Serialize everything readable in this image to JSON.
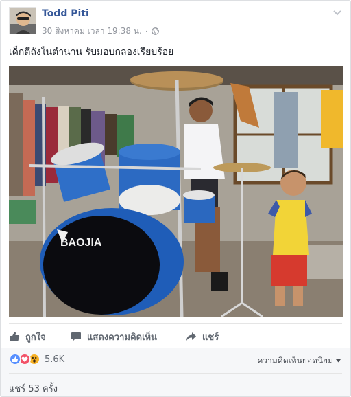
{
  "post": {
    "author": "Todd Piti",
    "timestamp": "30 สิงหาคม เวลา 19:38 น.",
    "separator": "·",
    "privacy_icon": "globe-icon",
    "caption": "เด็กตีถังในตำนาน รับมอบกลองเรียบร้อย",
    "photo_brand_text": "BAOJIA"
  },
  "actions": {
    "like_label": "ถูกใจ",
    "comment_label": "แสดงความคิดเห็น",
    "share_label": "แชร์"
  },
  "stats": {
    "reactions": [
      "like",
      "love",
      "wow"
    ],
    "reaction_count": "5.6K",
    "top_comments_label": "ความคิดเห็นยอดนิยม",
    "shares_label": "แชร์ 53 ครั้ง"
  },
  "colors": {
    "author": "#365899",
    "like": "#5890ff",
    "love": "#f25268",
    "wow": "#f7b125"
  }
}
